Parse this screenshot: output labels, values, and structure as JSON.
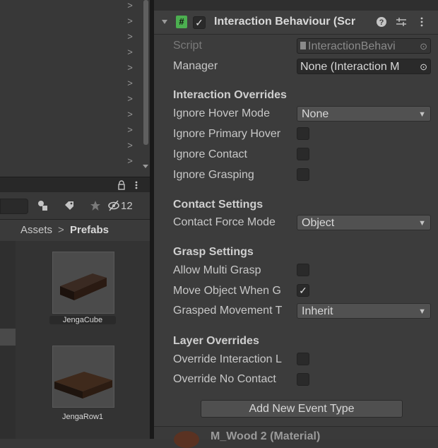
{
  "hierarchy": {
    "chevron": ">"
  },
  "project": {
    "lock_icon": "lock-icon",
    "menu_icon": "kebab-menu-icon",
    "toolbar": {
      "hidden_count": "12"
    },
    "breadcrumb": {
      "parent": "Assets",
      "separator": ">",
      "current": "Prefabs"
    },
    "assets": [
      {
        "label": "JengaCube"
      },
      {
        "label": "JengaRow1"
      }
    ]
  },
  "inspector": {
    "component": {
      "title": "Interaction Behaviour (Scr",
      "enabled": true
    },
    "script": {
      "label": "Script",
      "value": "InteractionBehavi"
    },
    "manager": {
      "label": "Manager",
      "value": "None (Interaction M"
    },
    "sections": {
      "interaction_overrides": "Interaction Overrides",
      "contact_settings": "Contact Settings",
      "grasp_settings": "Grasp Settings",
      "layer_overrides": "Layer Overrides"
    },
    "fields": {
      "ignore_hover_mode": {
        "label": "Ignore Hover Mode",
        "value": "None"
      },
      "ignore_primary_hover": {
        "label": "Ignore Primary Hover",
        "checked": false
      },
      "ignore_contact": {
        "label": "Ignore Contact",
        "checked": false
      },
      "ignore_grasping": {
        "label": "Ignore Grasping",
        "checked": false
      },
      "contact_force_mode": {
        "label": "Contact Force Mode",
        "value": "Object"
      },
      "allow_multi_grasp": {
        "label": "Allow Multi Grasp",
        "checked": false
      },
      "move_object_when_grasped": {
        "label": "Move Object When G",
        "checked": true,
        "mark": "✓"
      },
      "grasped_movement_type": {
        "label": "Grasped Movement T",
        "value": "Inherit"
      },
      "override_interaction_layer": {
        "label": "Override Interaction L",
        "checked": false
      },
      "override_no_contact": {
        "label": "Override No Contact",
        "checked": false
      }
    },
    "add_event_button": "Add New Event Type",
    "next_component": {
      "title": "M_Wood 2 (Material)"
    }
  },
  "colors": {
    "accent_check": "#e0e0e0",
    "script_icon": "#4caf50",
    "panel_bg": "#3c3c3c"
  }
}
